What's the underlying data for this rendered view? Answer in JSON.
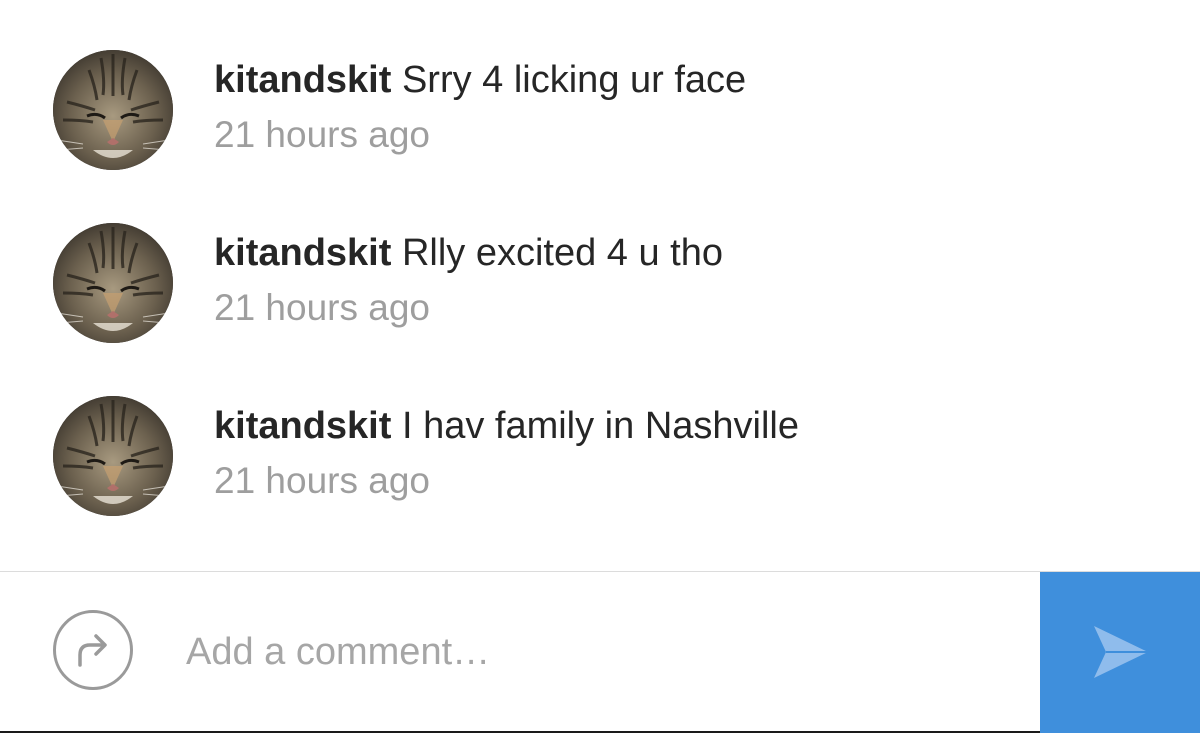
{
  "comments": [
    {
      "username": "kitandskit",
      "text": "Srry 4 licking ur face",
      "timestamp": "21 hours ago"
    },
    {
      "username": "kitandskit",
      "text": "Rlly excited 4 u tho",
      "timestamp": "21 hours ago"
    },
    {
      "username": "kitandskit",
      "text": "I hav family in Nashville",
      "timestamp": "21 hours ago"
    }
  ],
  "composer": {
    "placeholder": "Add a comment…",
    "share_icon": "share-arrow-icon",
    "send_icon": "send-paper-plane-icon"
  },
  "colors": {
    "accent": "#3f8fdc",
    "text": "#262626",
    "muted": "#9e9e9e"
  }
}
